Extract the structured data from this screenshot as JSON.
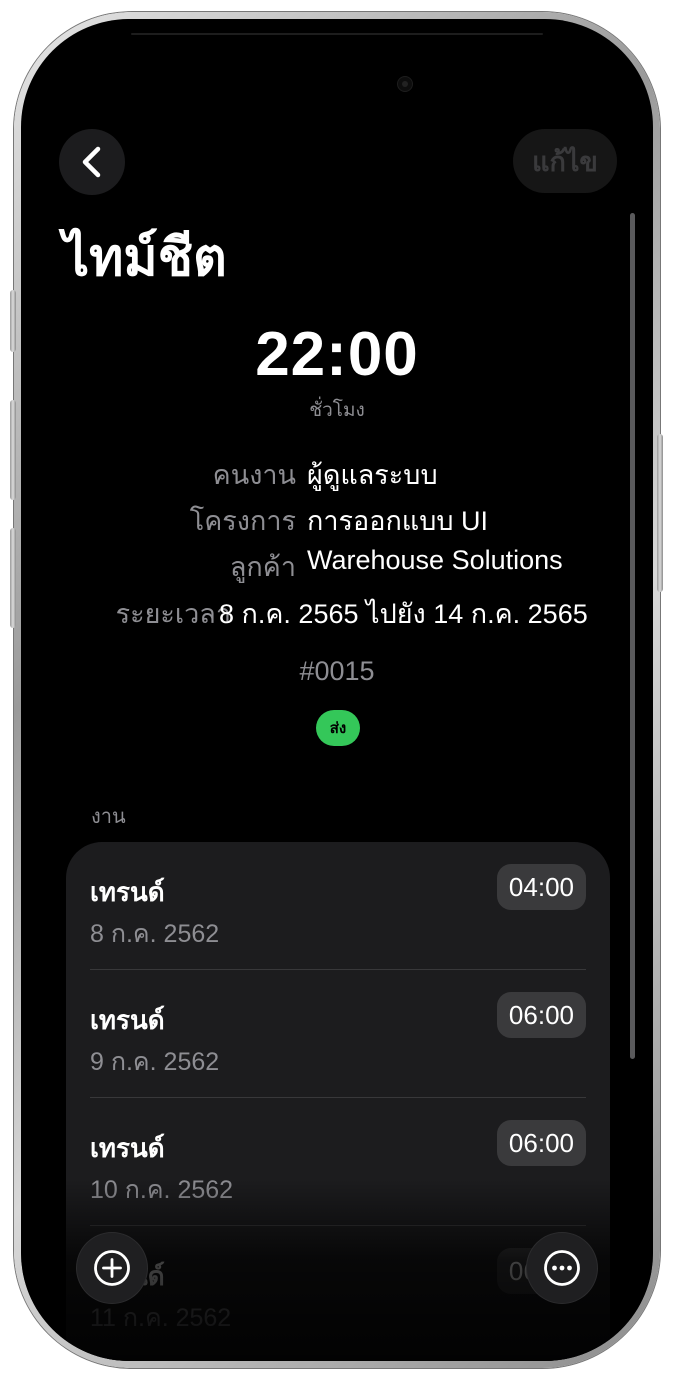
{
  "header": {
    "back_icon": "chevron-left-icon",
    "edit_label": "แก้ไข",
    "title": "ไทม์ชีต"
  },
  "summary": {
    "total_hours": "22:00",
    "hours_unit": "ชั่วโมง",
    "rows": [
      {
        "label": "คนงาน",
        "value": "ผู้ดูแลระบบ"
      },
      {
        "label": "โครงการ",
        "value": "การออกแบบ UI"
      },
      {
        "label": "ลูกค้า",
        "value": "Warehouse Solutions"
      },
      {
        "label": "ระยะเวลา",
        "value": "8 ก.ค. 2565 ไปยัง 14 ก.ค. 2565"
      }
    ],
    "number": "#0015",
    "status": "ส่ง",
    "status_color": "#34c759"
  },
  "tasks": {
    "section_label": "งาน",
    "items": [
      {
        "title": "เทรนด์",
        "date": "8 ก.ค. 2562",
        "hours": "04:00"
      },
      {
        "title": "เทรนด์",
        "date": "9 ก.ค. 2562",
        "hours": "06:00"
      },
      {
        "title": "เทรนด์",
        "date": "10 ก.ค. 2562",
        "hours": "06:00"
      },
      {
        "title": "เทรนด์",
        "date": "11 ก.ค. 2562",
        "hours": "06:00"
      }
    ]
  },
  "toolbar": {
    "add_icon": "plus-circle-icon",
    "more_icon": "ellipsis-circle-icon"
  }
}
